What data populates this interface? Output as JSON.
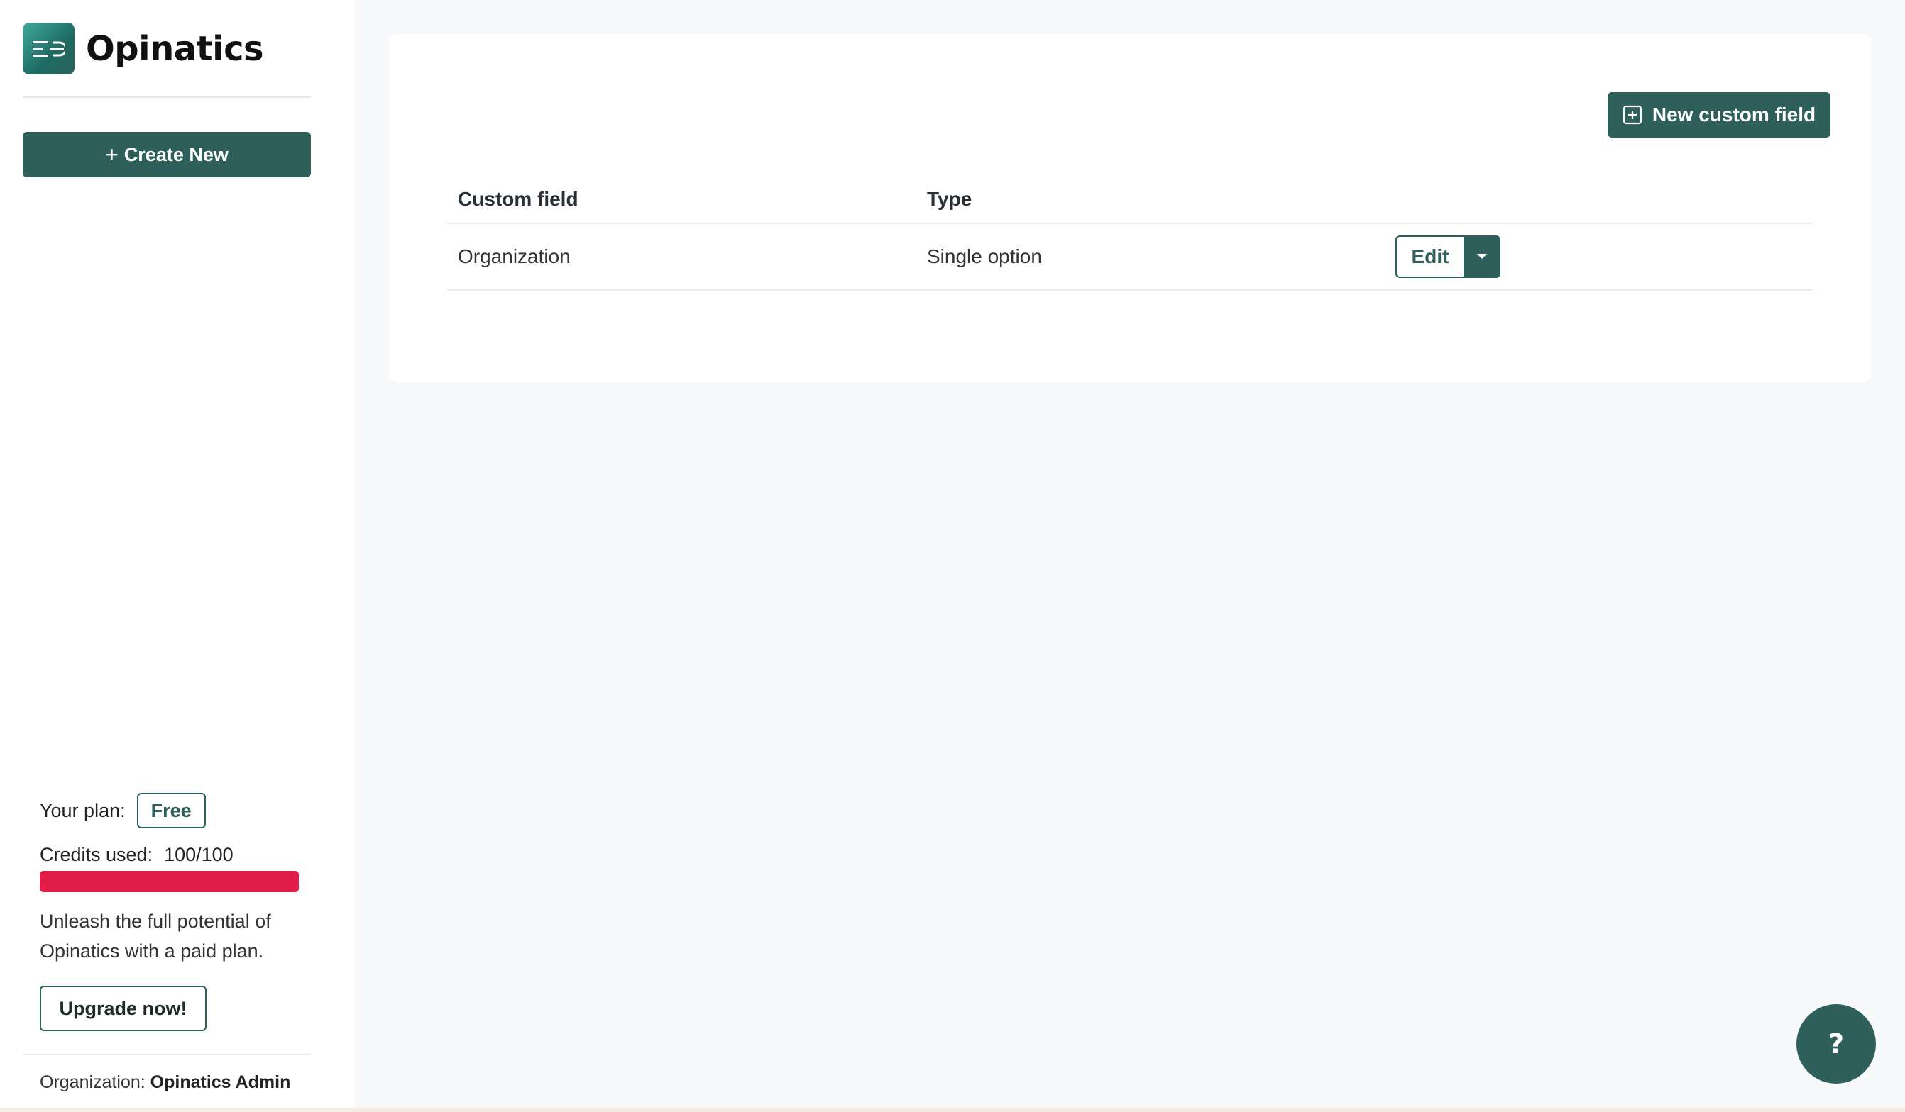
{
  "brand": {
    "name": "Opinatics",
    "logo_icon": "opinatics-logo-icon"
  },
  "sidebar": {
    "create_label": "Create New",
    "plan_label": "Your plan:",
    "plan_value": "Free",
    "credits_label": "Credits used:",
    "credits_value": "100/100",
    "credits_fraction": 1.0,
    "credits_bar_color": "#e11d48",
    "upsell_text": "Unleash the full potential of Opinatics with a paid plan.",
    "upgrade_label": "Upgrade now!",
    "org_label": "Organization:",
    "org_name": "Opinatics Admin"
  },
  "main": {
    "new_field_label": "New custom field",
    "table": {
      "headers": {
        "field": "Custom field",
        "type": "Type"
      },
      "rows": [
        {
          "field": "Organization",
          "type": "Single option",
          "edit_label": "Edit"
        }
      ]
    }
  },
  "help": {
    "label": "?"
  },
  "colors": {
    "accent": "#2e5f5a",
    "danger": "#e11d48",
    "background": "#f8f9fa"
  }
}
